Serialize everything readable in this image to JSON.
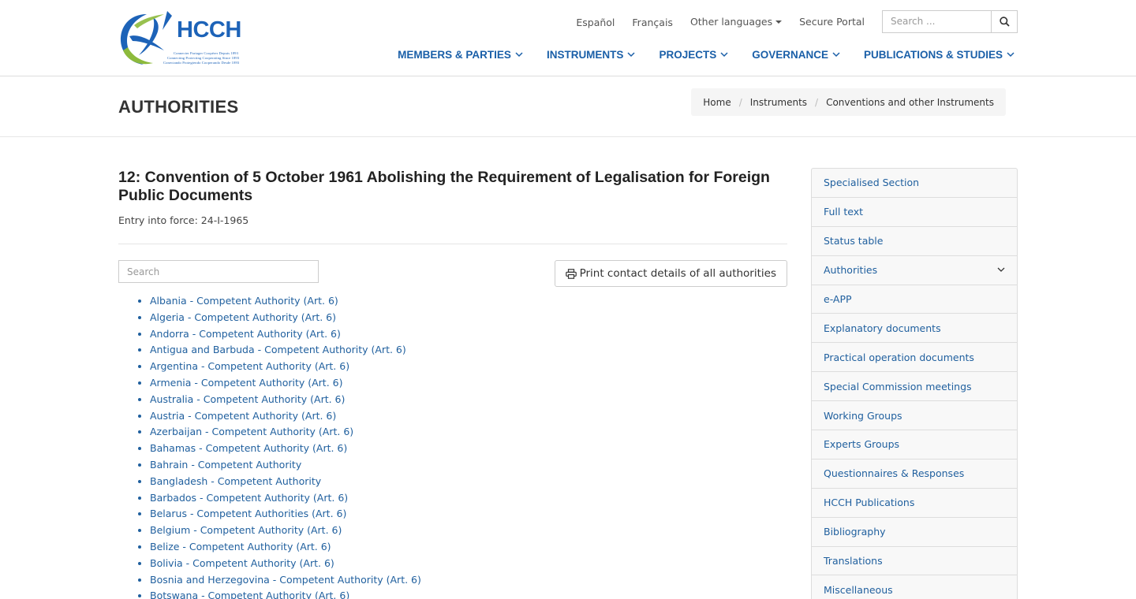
{
  "logo": {
    "text": "HCCH",
    "tagline": [
      "Connecter Partager Coopérer Depuis 1893",
      "Connecting Protecting Cooperating Since 1893",
      "Conectando Protegiendo Cooperando Desde 1893"
    ]
  },
  "topbar": {
    "espanol": "Español",
    "francais": "Français",
    "other_languages": "Other languages",
    "secure_portal": "Secure Portal",
    "search_placeholder": "Search ..."
  },
  "nav": [
    "MEMBERS & PARTIES",
    "INSTRUMENTS",
    "PROJECTS",
    "GOVERNANCE",
    "PUBLICATIONS & STUDIES"
  ],
  "page": {
    "title": "AUTHORITIES",
    "breadcrumb": [
      "Home",
      "Instruments",
      "Conventions and other Instruments"
    ]
  },
  "convention": {
    "title": "12: Convention of 5 October 1961 Abolishing the Requirement of Legalisation for Foreign Public Documents",
    "entry": "Entry into force: 24-I-1965"
  },
  "list_search_placeholder": "Search",
  "print_label": "Print contact details of all authorities",
  "authorities": [
    "Albania - Competent Authority (Art. 6)",
    "Algeria - Competent Authority (Art. 6)",
    "Andorra - Competent Authority (Art. 6)",
    "Antigua and Barbuda - Competent Authority (Art. 6)",
    "Argentina - Competent Authority (Art. 6)",
    "Armenia - Competent Authority (Art. 6)",
    "Australia - Competent Authority (Art. 6)",
    "Austria - Competent Authority (Art. 6)",
    "Azerbaijan - Competent Authority (Art. 6)",
    "Bahamas - Competent Authority (Art. 6)",
    "Bahrain - Competent Authority",
    "Bangladesh - Competent Authority",
    "Barbados - Competent Authority (Art. 6)",
    "Belarus - Competent Authorities (Art. 6)",
    "Belgium - Competent Authority (Art. 6)",
    "Belize - Competent Authority (Art. 6)",
    "Bolivia - Competent Authority (Art. 6)",
    "Bosnia and Herzegovina - Competent Authority (Art. 6)",
    "Botswana - Competent Authority (Art. 6)"
  ],
  "sidebar": [
    "Specialised Section",
    "Full text",
    "Status table",
    "Authorities",
    "e-APP",
    "Explanatory documents",
    "Practical operation documents",
    "Special Commission meetings",
    "Working Groups",
    "Experts Groups",
    "Questionnaires & Responses",
    "HCCH Publications",
    "Bibliography",
    "Translations",
    "Miscellaneous"
  ],
  "colors": {
    "link": "#1f5f9e",
    "nav": "#1a5fa8",
    "logo_blue": "#1d63b8",
    "logo_green": "#8dba3c"
  }
}
